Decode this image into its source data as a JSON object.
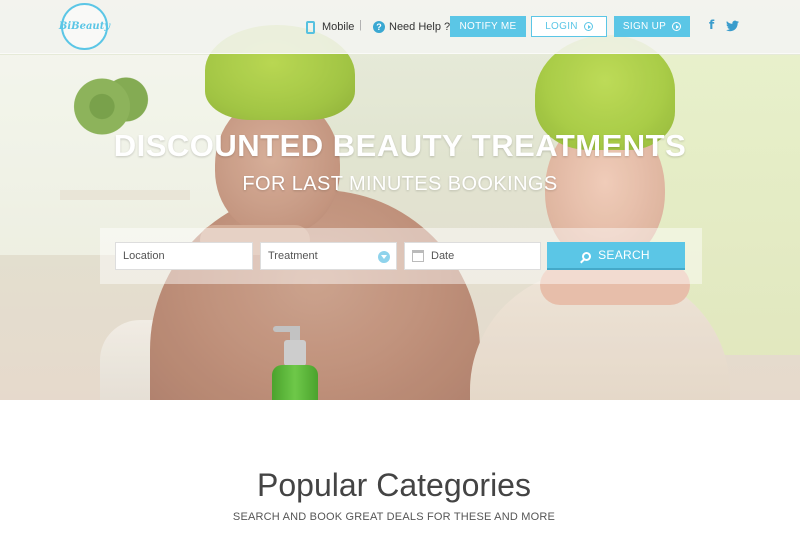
{
  "header": {
    "logo_text": "BiBeauty",
    "mobile_label": "Mobile",
    "separator": "|",
    "help_label": "Need Help ?",
    "notify_label": "NOTIFY ME",
    "login_label": "LOGIN",
    "signup_label": "SIGN UP",
    "facebook_glyph": "f",
    "icons": [
      "mobile-icon",
      "help-icon",
      "arrow-circle-icon",
      "facebook-icon",
      "twitter-icon"
    ]
  },
  "hero": {
    "title": "DISCOUNTED BEAUTY TREATMENTS",
    "subtitle": "FOR LAST MINUTES BOOKINGS"
  },
  "search": {
    "location_placeholder": "Location",
    "treatment_placeholder": "Treatment",
    "date_placeholder": "Date",
    "search_label": "SEARCH"
  },
  "popular": {
    "title": "Popular Categories",
    "subtitle": "SEARCH AND BOOK GREAT DEALS FOR THESE AND MORE"
  },
  "colors": {
    "accent": "#5bc6e6",
    "accent_dark": "#3aa8d2",
    "text": "#444444"
  }
}
